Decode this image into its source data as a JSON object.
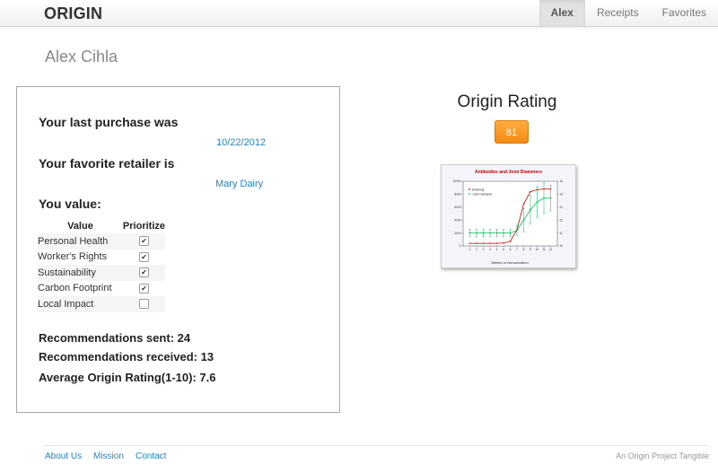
{
  "navbar": {
    "brand": "ORIGIN",
    "items": [
      {
        "label": "Alex",
        "active": true
      },
      {
        "label": "Receipts",
        "active": false
      },
      {
        "label": "Favorites",
        "active": false
      }
    ]
  },
  "profile": {
    "name": "Alex Cihla"
  },
  "stats": {
    "last_purchase_label": "Your last purchase was",
    "last_purchase_date": "10/22/2012",
    "favorite_retailer_label": "Your favorite retailer is",
    "favorite_retailer": "Mary Dairy",
    "values_heading": "You value:",
    "values_table": {
      "headers": [
        "Value",
        "Prioritize"
      ],
      "rows": [
        {
          "label": "Personal Health",
          "checked": true
        },
        {
          "label": "Worker's Rights",
          "checked": true
        },
        {
          "label": "Sustainability",
          "checked": true
        },
        {
          "label": "Carbon Footprint",
          "checked": true
        },
        {
          "label": "Local Impact",
          "checked": false
        }
      ]
    },
    "recommendations_sent": "Recommendations sent: 24",
    "recommendations_received": "Recommendations received: 13",
    "average_rating": "Average Origin Rating(1-10): 7.6"
  },
  "rating": {
    "title": "Origin Rating",
    "value": "81"
  },
  "chart_data": {
    "type": "line",
    "title": "Antibodies and Joint Diameters",
    "xlabel": "Weeks of Immunization",
    "ylabel": "",
    "x": [
      0,
      1,
      2,
      3,
      4,
      5,
      6,
      7,
      8,
      9,
      10,
      11,
      12
    ],
    "xlim": [
      -1,
      13
    ],
    "ylim": [
      0,
      10000
    ],
    "y_ticks": [
      "0",
      "2000",
      "4000",
      "6000",
      "8000",
      "10000"
    ],
    "y2lim": [
      10,
      15
    ],
    "y2_ticks": [
      "10",
      "11",
      "12",
      "13",
      "14",
      "15"
    ],
    "series": [
      {
        "name": "Antibody",
        "axis": "left",
        "color": "#cc0000",
        "values": [
          400,
          400,
          400,
          400,
          400,
          450,
          700,
          2500,
          6500,
          8400,
          8700,
          8800,
          8800
        ]
      },
      {
        "name": "Joint Diameter",
        "axis": "right",
        "color": "#00bb55",
        "values": [
          11.0,
          11.0,
          11.0,
          11.0,
          11.0,
          11.0,
          11.0,
          11.2,
          12.0,
          12.8,
          13.4,
          13.7,
          13.7
        ],
        "errors": [
          0.3,
          0.3,
          0.3,
          0.3,
          0.3,
          0.3,
          0.3,
          0.4,
          0.9,
          1.1,
          1.2,
          1.2,
          1.0
        ]
      }
    ],
    "legend": "top-left",
    "grid": false
  },
  "footer": {
    "links": [
      "About Us",
      "Mission",
      "Contact"
    ],
    "note": "An Origin Project Tangible"
  }
}
